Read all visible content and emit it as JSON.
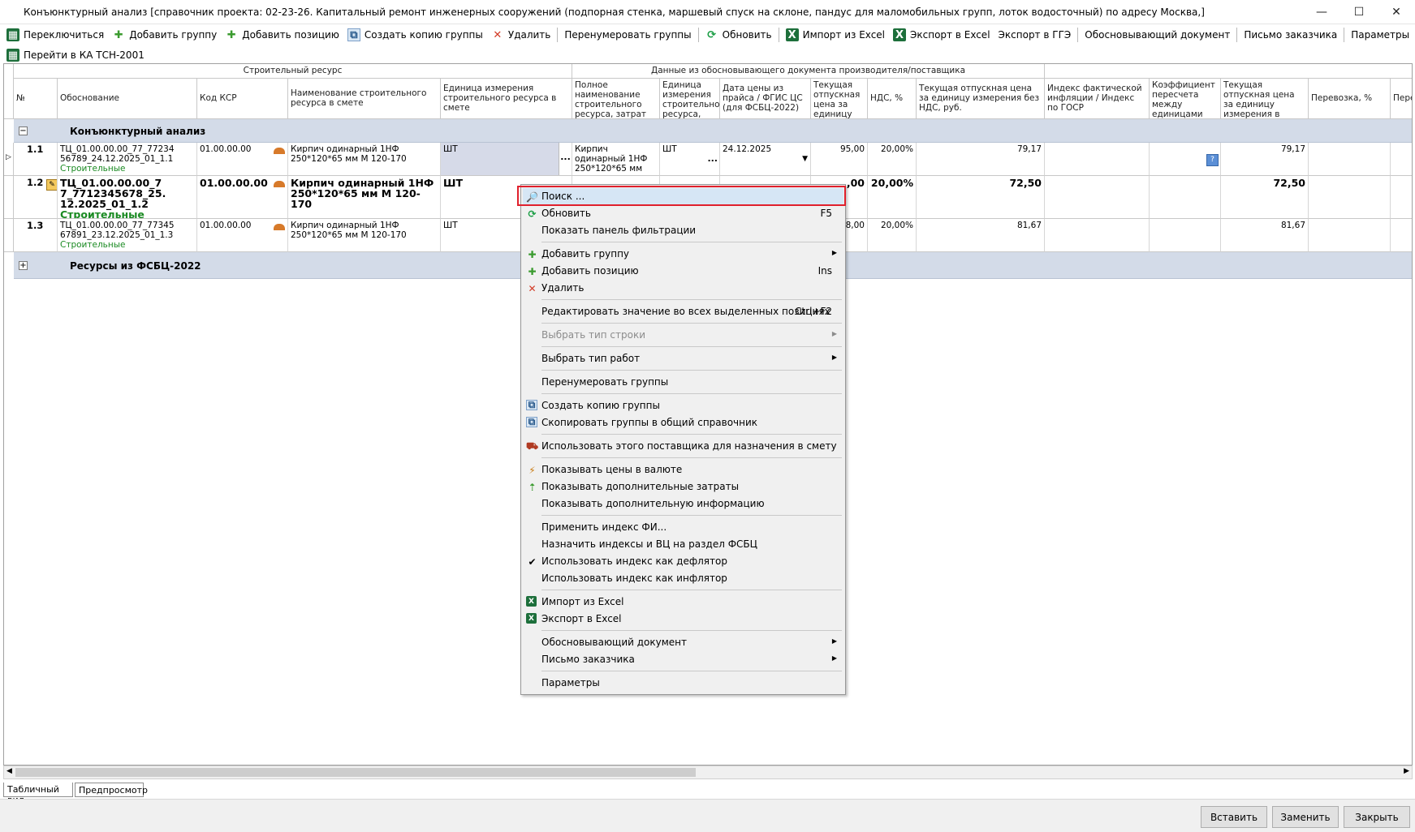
{
  "window": {
    "title": "Конъюнктурный анализ [справочник проекта: 02-23-26. Капитальный ремонт инженерных сооружений (подпорная стенка, маршевый спуск на склоне, пандус для маломобильных групп, лоток водосточный) по адресу Москва,]",
    "controls": [
      "—",
      "☐",
      "✕"
    ]
  },
  "toolbar": {
    "switch": "Переключиться",
    "add_group": "Добавить группу",
    "add_position": "Добавить позицию",
    "copy_group": "Создать копию группы",
    "delete": "Удалить",
    "renumber": "Перенумеровать группы",
    "refresh": "Обновить",
    "import_excel": "Импорт из Excel",
    "export_excel": "Экспорт в Excel",
    "export_gge": "Экспорт в ГГЭ",
    "justify_doc": "Обосновывающий документ",
    "customer_letter": "Письмо заказчика",
    "params": "Параметры",
    "goto_tsn": "Перейти в КА ТСН-2001"
  },
  "grid": {
    "band1": "Строительный ресурс",
    "band2": "Данные из обосновывающего документа производителя/поставщика",
    "columns": {
      "num": "№",
      "basis": "Обоснование",
      "ksr": "Код КСР",
      "name": "Наименование строительного ресурса в смете",
      "unit": "Единица измерения строительного ресурса в смете",
      "fullname": "Полное наименование строительного ресурса, затрат",
      "unit2": "Единица измерения строительног ресурса,",
      "date": "Дата цены из прайса / ФГИС ЦС (для ФСБЦ-2022)",
      "price": "Текущая отпускная цена за единицу",
      "vat": "НДС, %",
      "price_novat": "Текущая отпускная цена за единицу измерения без НДС, руб.",
      "index": "Индекс фактической инфляции /  Индекс по ГОСР",
      "coef": "Коэффициент пересчета между единицами",
      "price_est": "Текущая отпускная цена за единицу измерения в смете без НДС, руб.",
      "transport": "Перевозка, %",
      "extra": "Пере"
    },
    "groups": [
      {
        "expander": "−",
        "label": "Конъюнктурный анализ"
      },
      {
        "expander": "+",
        "label": "Ресурсы из ФСБЦ-2022"
      }
    ],
    "rows": [
      {
        "num": "1.1",
        "basis1": "ТЦ_01.00.00.00_77_77234",
        "basis2": "56789_24.12.2025_01_1.1",
        "cat": "Строительные",
        "ksr": "01.00.00.00",
        "name": "Кирпич одинарный 1НФ 250*120*65 мм М 120-170",
        "unit": "ШТ",
        "fullname": "Кирпич одинарный 1НФ 250*120*65 мм",
        "unit2": "ШТ",
        "date": "24.12.2025",
        "price": "95,00",
        "vat": "20,00%",
        "price_novat": "79,17",
        "price_est": "79,17"
      },
      {
        "num": "1.2",
        "basis1": "ТЦ_01.00.00.00_7",
        "basis2": "7_7712345678_25.",
        "basis3": "12.2025_01_1.2",
        "cat": "Строительные",
        "ksr": "01.00.00.00",
        "name": "Кирпич одинарный 1НФ 250*120*65 мм М 120-170",
        "unit": "ШТ",
        "price": ",00",
        "vat": "20,00%",
        "price_novat": "72,50",
        "price_est": "72,50"
      },
      {
        "num": "1.3",
        "basis1": "ТЦ_01.00.00.00_77_77345",
        "basis2": "67891_23.12.2025_01_1.3",
        "cat": "Строительные",
        "ksr": "01.00.00.00",
        "name": "Кирпич одинарный 1НФ 250*120*65 мм М 120-170",
        "unit": "ШТ",
        "price": "8,00",
        "vat": "20,00%",
        "price_novat": "81,67",
        "price_est": "81,67"
      }
    ],
    "ellipsis": "..."
  },
  "context_menu": {
    "search": "Поиск ...",
    "refresh": "Обновить",
    "refresh_sc": "F5",
    "filter_panel": "Показать панель фильтрации",
    "add_group": "Добавить группу",
    "add_position": "Добавить позицию",
    "add_position_sc": "Ins",
    "delete": "Удалить",
    "edit_all": "Редактировать значение во всех выделенных позициях",
    "edit_all_sc": "Ctrl+F2",
    "row_type": "Выбрать тип строки",
    "work_type": "Выбрать тип работ",
    "renumber": "Перенумеровать группы",
    "copy_group": "Создать копию группы",
    "copy_to_common": "Скопировать группы в общий справочник",
    "use_supplier": "Использовать этого поставщика для назначения в смету",
    "show_currency": "Показывать цены в валюте",
    "show_extra_costs": "Показывать дополнительные затраты",
    "show_extra_info": "Показывать дополнительную информацию",
    "apply_index": "Применить индекс ФИ...",
    "assign_index": "Назначить индексы и ВЦ на раздел ФСБЦ",
    "use_deflator": "Использовать индекс как дефлятор",
    "use_inflator": "Использовать индекс как инфлятор",
    "import_excel": "Импорт из Excel",
    "export_excel": "Экспорт в Excel",
    "justify_doc": "Обосновывающий документ",
    "customer_letter": "Письмо заказчика",
    "params": "Параметры"
  },
  "tabs": {
    "table": "Табличный вид",
    "preview": "Предпросмотр"
  },
  "buttons": {
    "insert": "Вставить",
    "replace": "Заменить",
    "close": "Закрыть"
  }
}
